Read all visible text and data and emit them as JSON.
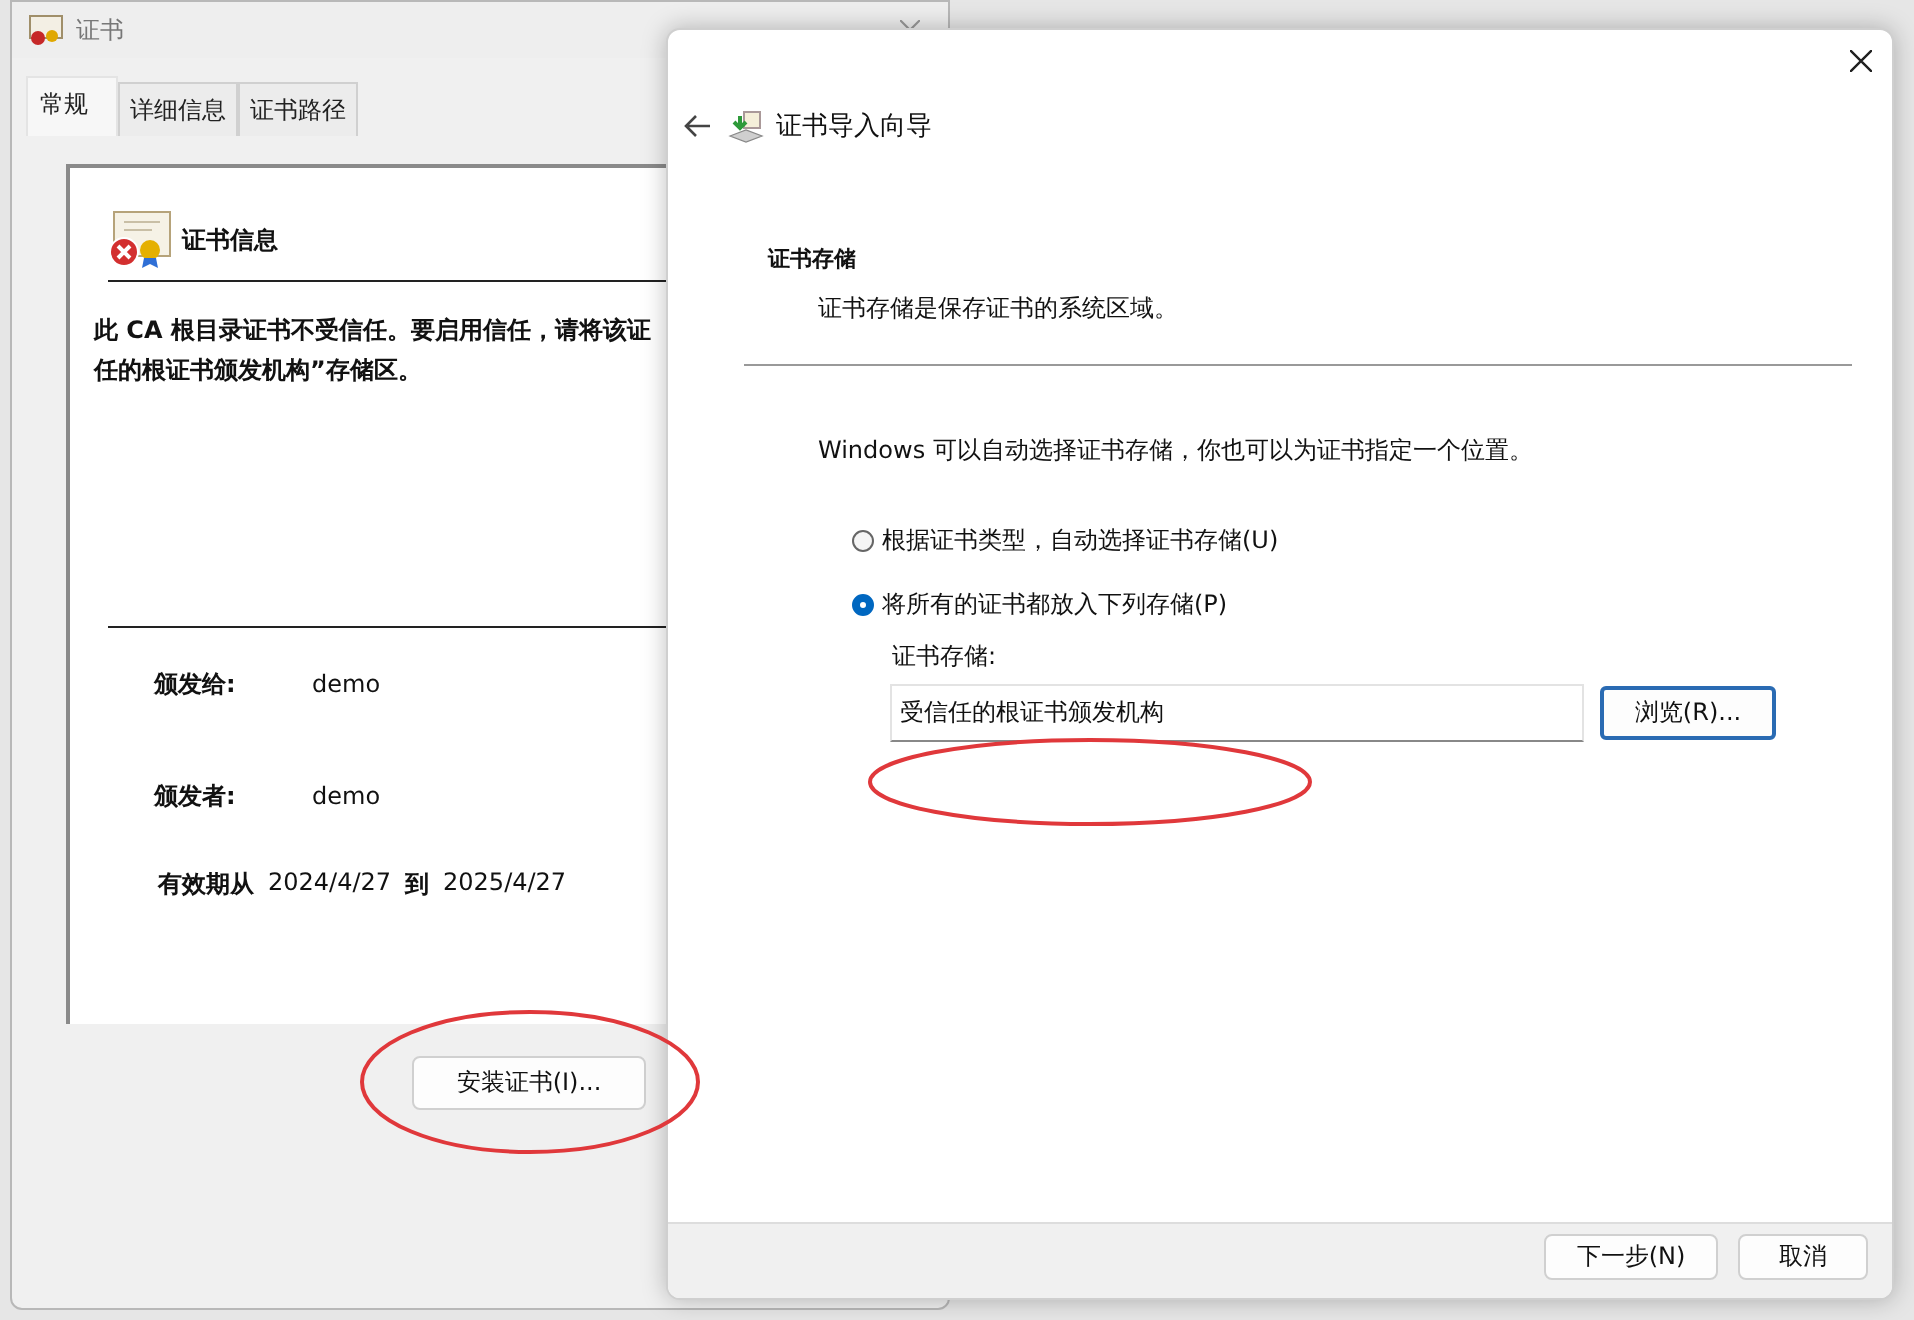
{
  "certificate_window": {
    "title": "证书",
    "tabs": [
      {
        "label": "常规",
        "selected": true
      },
      {
        "label": "详细信息",
        "selected": false
      },
      {
        "label": "证书路径",
        "selected": false
      }
    ],
    "header": "证书信息",
    "warning_lines": [
      "此 CA 根目录证书不受信任。要启用信任，请将该证",
      "任的根证书颁发机构”存储区。"
    ],
    "fields": [
      {
        "label": "颁发给:",
        "value": "demo"
      },
      {
        "label": "颁发者:",
        "value": "demo"
      }
    ],
    "validity": {
      "label": "有效期从",
      "from": "2024/4/27",
      "to_label": "到",
      "to": "2025/4/27"
    },
    "install_button": "安装证书(I)..."
  },
  "wizard": {
    "title": "证书导入向导",
    "section_title": "证书存储",
    "section_subtitle": "证书存储是保存证书的系统区域。",
    "intro": "Windows 可以自动选择证书存储，你也可以为证书指定一个位置。",
    "options": [
      {
        "label": "根据证书类型，自动选择证书存储(U)",
        "selected": false
      },
      {
        "label": "将所有的证书都放入下列存储(P)",
        "selected": true
      }
    ],
    "store_label": "证书存储:",
    "store_value": "受信任的根证书颁发机构",
    "browse_button": "浏览(R)...",
    "buttons": [
      "下一步(N)",
      "取消"
    ]
  }
}
